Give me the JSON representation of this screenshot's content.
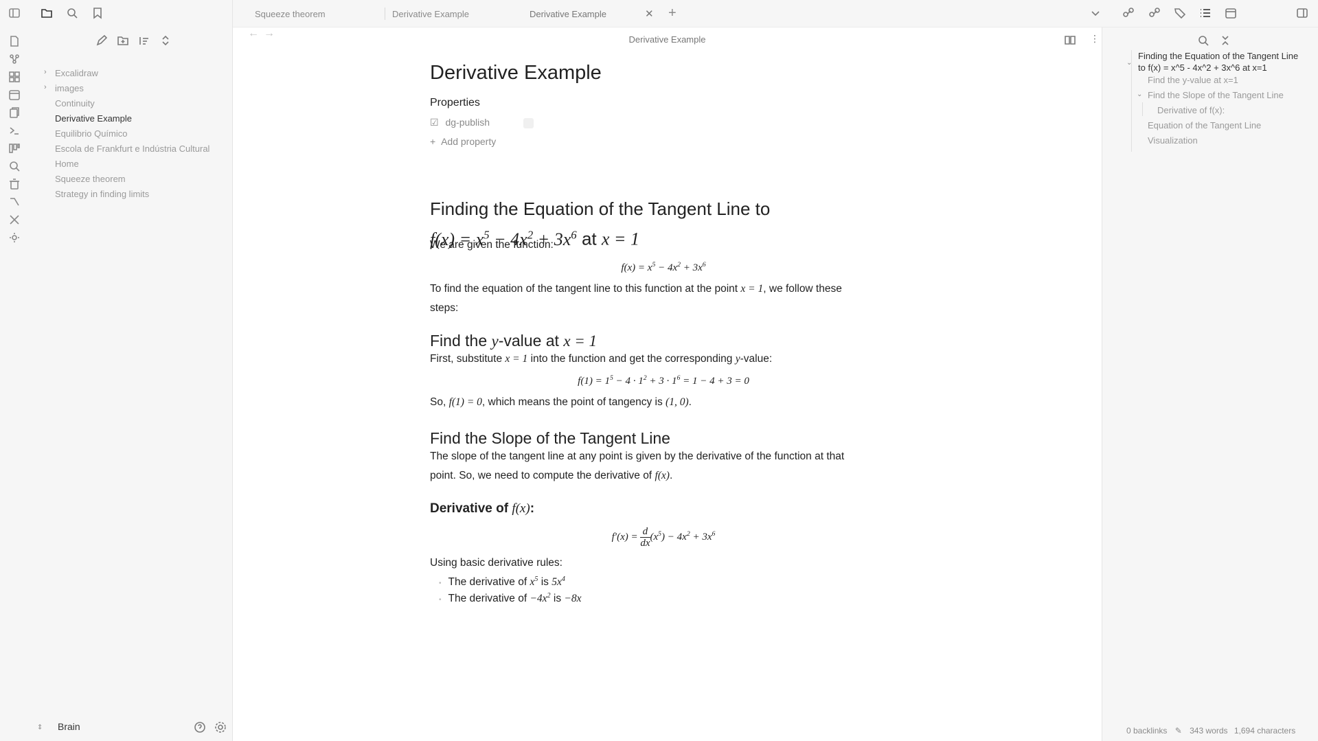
{
  "tabs": [
    {
      "label": "Squeeze theorem"
    },
    {
      "label": "Derivative Example"
    },
    {
      "label": "Derivative Example"
    }
  ],
  "header": {
    "title": "Derivative Example"
  },
  "files": [
    {
      "label": "Excalidraw",
      "folder": true
    },
    {
      "label": "images",
      "folder": true
    },
    {
      "label": "Continuity"
    },
    {
      "label": "Derivative Example",
      "active": true
    },
    {
      "label": "Equilibrio Químico"
    },
    {
      "label": "Escola de Frankfurt e Indústria Cultural"
    },
    {
      "label": "Home"
    },
    {
      "label": "Squeeze theorem"
    },
    {
      "label": "Strategy in finding limits"
    }
  ],
  "vault": {
    "name": "Brain"
  },
  "doc": {
    "title": "Derivative Example",
    "properties_label": "Properties",
    "property_key": "dg-publish",
    "add_property": "Add property",
    "h1_a": "Finding the Equation of the Tangent Line to",
    "h1_at": "at",
    "p_given": "We are given the function:",
    "p_find_a": "To find the equation of the tangent line to this function at the point",
    "p_find_b": ", we follow these",
    "p_find_c": "steps:",
    "h_yvalue_a": "Find the",
    "h_yvalue_b": "-value at",
    "p_subst_a": "First, substitute",
    "p_subst_b": "into the function and get the corresponding",
    "p_subst_c": "-value:",
    "p_so_a": "So,",
    "p_so_b": ", which means the point of tangency is",
    "h_slope": "Find the Slope of the Tangent Line",
    "p_slope_a": "The slope of the tangent line at any point is given by the derivative of the function at that",
    "p_slope_b": "point. So, we need to compute the derivative of",
    "h_deriv": "Derivative of",
    "p_rules": "Using basic derivative rules:",
    "bullet_a": "The derivative of",
    "bullet_is": "is"
  },
  "outline": [
    {
      "label": "Finding the Equation of the Tangent Line to f(x) = x^5 - 4x^2 + 3x^6 at x=1"
    },
    {
      "label": "Find the y-value at x=1"
    },
    {
      "label": "Find the Slope of the Tangent Line"
    },
    {
      "label": "Derivative of f(x):"
    },
    {
      "label": "Equation of the Tangent Line"
    },
    {
      "label": "Visualization"
    }
  ],
  "status": {
    "backlinks": "0 backlinks",
    "words": "343 words",
    "chars": "1,694 characters"
  },
  "colors": {
    "accent": "#222222",
    "muted": "#9a9a9a",
    "panel": "#f6f6f6"
  }
}
